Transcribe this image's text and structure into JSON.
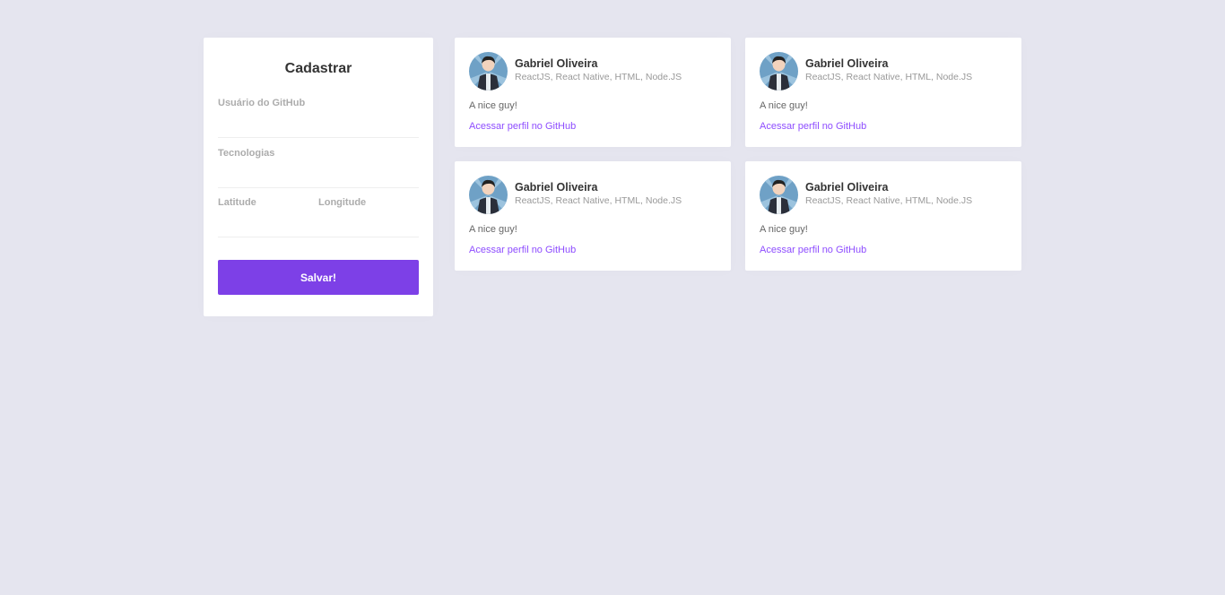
{
  "form": {
    "title": "Cadastrar",
    "github_username_label": "Usuário do GitHub",
    "techs_label": "Tecnologias",
    "latitude_label": "Latitude",
    "longitude_label": "Longitude",
    "github_username_value": "",
    "techs_value": "",
    "latitude_value": "",
    "longitude_value": "",
    "submit_label": "Salvar!"
  },
  "colors": {
    "background": "#e5e5ef",
    "accent": "#7d40e7",
    "link": "#8e4dff"
  },
  "devs": [
    {
      "name": "Gabriel Oliveira",
      "techs": "ReactJS, React Native, HTML, Node.JS",
      "bio": "A nice guy!",
      "link_label": "Acessar perfil no GitHub",
      "avatar_icon": "avatar-illustration-icon"
    },
    {
      "name": "Gabriel Oliveira",
      "techs": "ReactJS, React Native, HTML, Node.JS",
      "bio": "A nice guy!",
      "link_label": "Acessar perfil no GitHub",
      "avatar_icon": "avatar-illustration-icon"
    },
    {
      "name": "Gabriel Oliveira",
      "techs": "ReactJS, React Native, HTML, Node.JS",
      "bio": "A nice guy!",
      "link_label": "Acessar perfil no GitHub",
      "avatar_icon": "avatar-illustration-icon"
    },
    {
      "name": "Gabriel Oliveira",
      "techs": "ReactJS, React Native, HTML, Node.JS",
      "bio": "A nice guy!",
      "link_label": "Acessar perfil no GitHub",
      "avatar_icon": "avatar-illustration-icon"
    }
  ]
}
